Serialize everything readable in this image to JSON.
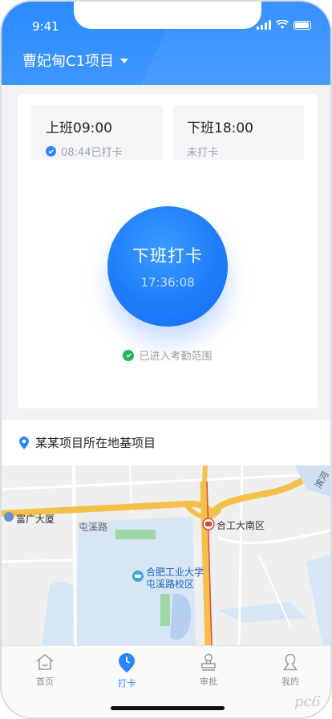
{
  "status_bar": {
    "time": "9:41"
  },
  "header": {
    "project_name": "曹妃甸C1项目"
  },
  "shifts": [
    {
      "title": "上班09:00",
      "status": "08:44已打卡",
      "checked": true
    },
    {
      "title": "下班18:00",
      "status": "未打卡",
      "checked": false
    }
  ],
  "punch": {
    "label": "下班打卡",
    "time": "17:36:08"
  },
  "range_status": "已进入考勤范围",
  "location": {
    "label": "某某项目所在地基项目"
  },
  "map": {
    "labels": {
      "fuguang": "富广大厦",
      "tunxi_road": "屯溪路",
      "hegong_south": "合工大南区",
      "campus_line1": "合肥工业大学",
      "campus_line2": "屯溪路校区",
      "binhe": "滨河"
    }
  },
  "tabs": [
    {
      "label": "首页",
      "icon": "home-icon"
    },
    {
      "label": "打卡",
      "icon": "clock-pin-icon"
    },
    {
      "label": "审批",
      "icon": "stamp-icon"
    },
    {
      "label": "我的",
      "icon": "user-icon"
    }
  ],
  "active_tab": "打卡",
  "watermark": "pc6",
  "colors": {
    "primary": "#2a86ff",
    "success": "#22b35a",
    "header_bg": "#3490ff"
  }
}
